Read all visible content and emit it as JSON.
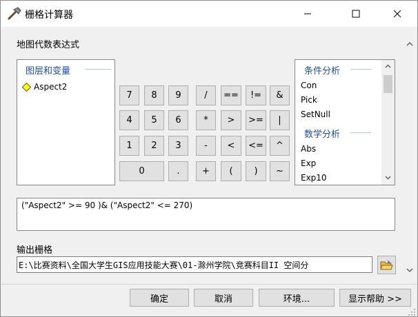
{
  "window": {
    "title": "栅格计算器",
    "controls": {
      "minimize": "minimize",
      "maximize": "maximize",
      "close": "close"
    }
  },
  "expression_section_label": "地图代数表达式",
  "layers": {
    "header": "图层和变量",
    "items": [
      {
        "label": "Aspect2"
      }
    ]
  },
  "keypad": [
    {
      "label": "7"
    },
    {
      "label": "8"
    },
    {
      "label": "9"
    },
    {
      "label": "/"
    },
    {
      "label": "=="
    },
    {
      "label": "!="
    },
    {
      "label": "&"
    },
    {
      "label": "4"
    },
    {
      "label": "5"
    },
    {
      "label": "6"
    },
    {
      "label": "*"
    },
    {
      "label": ">"
    },
    {
      "label": ">="
    },
    {
      "label": "|"
    },
    {
      "label": "1"
    },
    {
      "label": "2"
    },
    {
      "label": "3"
    },
    {
      "label": "-"
    },
    {
      "label": "<"
    },
    {
      "label": "<="
    },
    {
      "label": "^"
    },
    {
      "label": "0"
    },
    {
      "label": "."
    },
    {
      "label": "+"
    },
    {
      "label": "("
    },
    {
      "label": ")"
    },
    {
      "label": "~"
    }
  ],
  "functions": {
    "groups": [
      {
        "header": "条件分析",
        "items": [
          "Con",
          "Pick",
          "SetNull"
        ]
      },
      {
        "header": "数学分析",
        "items": [
          "Abs",
          "Exp",
          "Exp10"
        ]
      }
    ]
  },
  "expression_text": "(\"Aspect2\" >= 90 )& (\"Aspect2\" <= 270)",
  "output": {
    "label": "输出栅格",
    "path": "E:\\比赛资料\\全国大学生GIS应用技能大赛\\01-滁州学院\\竞赛科目II 空间分"
  },
  "buttons": {
    "ok": "确定",
    "cancel": "取消",
    "environments": "环境...",
    "show_help": "显示帮助 >>"
  },
  "icons": {
    "app": "hammer-icon",
    "folder": "open-folder-icon"
  },
  "colors": {
    "group_header": "#1f4e9c",
    "layer_diamond": "#ffff00",
    "folder": "#f2b635"
  }
}
